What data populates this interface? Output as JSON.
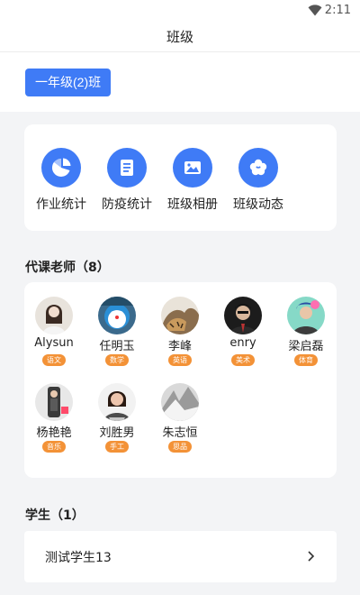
{
  "status": {
    "time": "2:11"
  },
  "header": {
    "title": "班级"
  },
  "class_chip": {
    "label": "一年级(2)班"
  },
  "functions": [
    {
      "label": "作业统计",
      "icon": "pie-chart-icon"
    },
    {
      "label": "防疫统计",
      "icon": "document-icon"
    },
    {
      "label": "班级相册",
      "icon": "image-icon"
    },
    {
      "label": "班级动态",
      "icon": "flower-icon"
    }
  ],
  "teachers_section": {
    "title": "代课老师（8）"
  },
  "teachers": [
    {
      "name": "Alysun",
      "subject": "语文"
    },
    {
      "name": "任明玉",
      "subject": "数学"
    },
    {
      "name": "李峰",
      "subject": "英语"
    },
    {
      "name": "enry",
      "subject": "美术"
    },
    {
      "name": "梁启磊",
      "subject": "体育"
    },
    {
      "name": "杨艳艳",
      "subject": "音乐"
    },
    {
      "name": "刘胜男",
      "subject": "手工"
    },
    {
      "name": "朱志恒",
      "subject": "思品"
    }
  ],
  "students_section": {
    "title": "学生（1）"
  },
  "students": [
    {
      "name": "测试学生13"
    }
  ],
  "colors": {
    "primary": "#3f7bf6",
    "tag": "#f39237",
    "background": "#f3f4f6"
  }
}
